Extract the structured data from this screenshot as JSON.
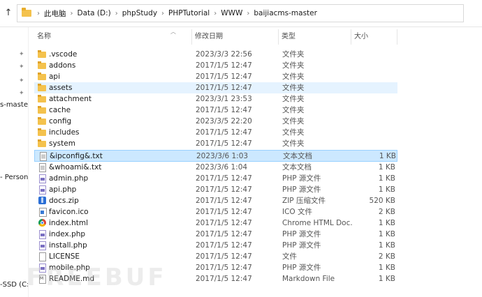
{
  "address_bar": {
    "crumbs": [
      "此电脑",
      "Data (D:)",
      "phpStudy",
      "PHPTutorial",
      "WWW",
      "baijiacms-master"
    ]
  },
  "nav_pane": {
    "labels": [
      "s-master",
      "- Persona",
      "-SSD (C:"
    ]
  },
  "columns": {
    "name": "名称",
    "modified": "修改日期",
    "type": "类型",
    "size": "大小"
  },
  "files": [
    {
      "name": ".vscode",
      "date": "2023/3/3 22:56",
      "type": "文件夹",
      "size": "",
      "icon": "folder-icon"
    },
    {
      "name": "addons",
      "date": "2017/1/5 12:47",
      "type": "文件夹",
      "size": "",
      "icon": "folder-icon"
    },
    {
      "name": "api",
      "date": "2017/1/5 12:47",
      "type": "文件夹",
      "size": "",
      "icon": "folder-icon"
    },
    {
      "name": "assets",
      "date": "2017/1/5 12:47",
      "type": "文件夹",
      "size": "",
      "icon": "folder-icon"
    },
    {
      "name": "attachment",
      "date": "2023/3/1 23:53",
      "type": "文件夹",
      "size": "",
      "icon": "folder-icon"
    },
    {
      "name": "cache",
      "date": "2017/1/5 12:47",
      "type": "文件夹",
      "size": "",
      "icon": "folder-icon"
    },
    {
      "name": "config",
      "date": "2023/3/5 22:20",
      "type": "文件夹",
      "size": "",
      "icon": "folder-icon"
    },
    {
      "name": "includes",
      "date": "2017/1/5 12:47",
      "type": "文件夹",
      "size": "",
      "icon": "folder-icon"
    },
    {
      "name": "system",
      "date": "2017/1/5 12:47",
      "type": "文件夹",
      "size": "",
      "icon": "folder-icon"
    },
    {
      "name": "&ipconfig&.txt",
      "date": "2023/3/6 1:03",
      "type": "文本文档",
      "size": "1 KB",
      "icon": "text-file-icon"
    },
    {
      "name": "&whoami&.txt",
      "date": "2023/3/6 1:04",
      "type": "文本文档",
      "size": "1 KB",
      "icon": "text-file-icon"
    },
    {
      "name": "admin.php",
      "date": "2017/1/5 12:47",
      "type": "PHP 源文件",
      "size": "1 KB",
      "icon": "php-file-icon"
    },
    {
      "name": "api.php",
      "date": "2017/1/5 12:47",
      "type": "PHP 源文件",
      "size": "1 KB",
      "icon": "php-file-icon"
    },
    {
      "name": "docs.zip",
      "date": "2017/1/5 12:47",
      "type": "ZIP 压缩文件",
      "size": "520 KB",
      "icon": "zip-file-icon"
    },
    {
      "name": "favicon.ico",
      "date": "2017/1/5 12:47",
      "type": "ICO 文件",
      "size": "2 KB",
      "icon": "ico-file-icon"
    },
    {
      "name": "index.html",
      "date": "2017/1/5 12:47",
      "type": "Chrome HTML Doc...",
      "size": "1 KB",
      "icon": "chrome-icon"
    },
    {
      "name": "index.php",
      "date": "2017/1/5 12:47",
      "type": "PHP 源文件",
      "size": "1 KB",
      "icon": "php-file-icon"
    },
    {
      "name": "install.php",
      "date": "2017/1/5 12:47",
      "type": "PHP 源文件",
      "size": "1 KB",
      "icon": "php-file-icon"
    },
    {
      "name": "LICENSE",
      "date": "2017/1/5 12:47",
      "type": "文件",
      "size": "2 KB",
      "icon": "blank-file-icon"
    },
    {
      "name": "mobile.php",
      "date": "2017/1/5 12:47",
      "type": "PHP 源文件",
      "size": "1 KB",
      "icon": "php-file-icon"
    },
    {
      "name": "README.md",
      "date": "2017/1/5 12:47",
      "type": "Markdown File",
      "size": "1 KB",
      "icon": "markdown-file-icon"
    }
  ],
  "watermark": "FREEBUF",
  "colors": {
    "folder": "#f4c24d",
    "hover_row": "#e5f3ff",
    "selected_row": "#cce8ff",
    "selected_border": "#99d1ff"
  }
}
